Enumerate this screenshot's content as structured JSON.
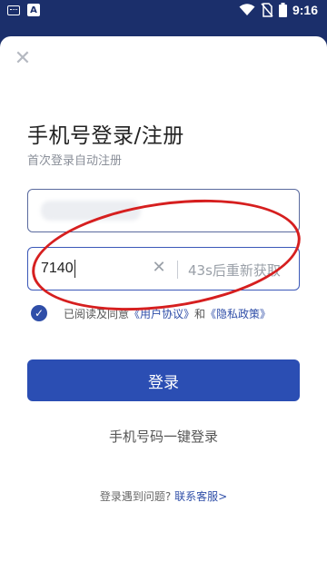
{
  "status_bar": {
    "time": "9:16",
    "icons": [
      "keyboard-icon",
      "a-icon",
      "wifi-icon",
      "no-sim-icon",
      "battery-icon"
    ]
  },
  "card": {
    "close_icon": "close-icon",
    "title": "手机号登录/注册",
    "subtitle": "首次登录自动注册",
    "code_input": {
      "value": "7140",
      "resend_label": "43s后重新获取"
    },
    "agreement": {
      "prefix": "已阅读及同意",
      "user_agreement": "《用户协议》",
      "and": "和",
      "privacy_policy": "《隐私政策》"
    },
    "login_button": "登录",
    "oneclick_login": "手机号码一键登录",
    "help_question": "登录遇到问题?",
    "help_link": "联系客服>"
  },
  "colors": {
    "header_bg": "#1b2f6b",
    "primary": "#2b4eb3",
    "annotation_red": "#d61f1f"
  }
}
